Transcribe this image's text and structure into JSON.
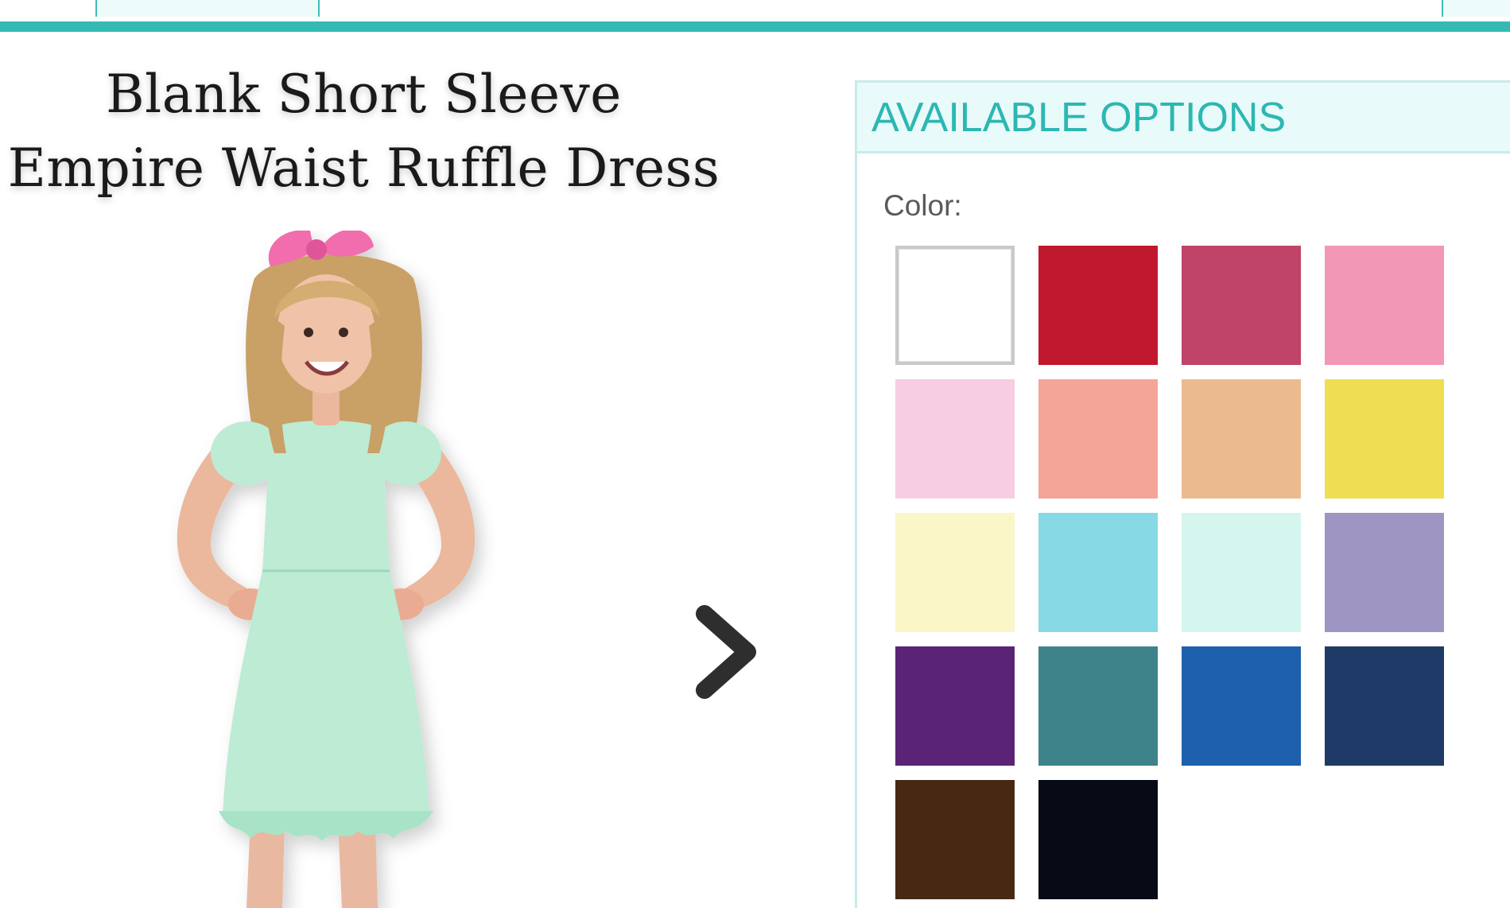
{
  "product": {
    "title": "Blank Short Sleeve Empire Waist Ruffle Dress"
  },
  "carousel": {
    "next_icon": "chevron-right-icon"
  },
  "options": {
    "header": "AVAILABLE OPTIONS",
    "color_label": "Color:",
    "selected_index": 0,
    "swatches": [
      {
        "color": "#FFFFFF"
      },
      {
        "color": "#C0192F"
      },
      {
        "color": "#C04468"
      },
      {
        "color": "#F297B6"
      },
      {
        "color": "#F6CDE3"
      },
      {
        "color": "#F4A597"
      },
      {
        "color": "#EBBB90"
      },
      {
        "color": "#F0DE52"
      },
      {
        "color": "#FBF6C7"
      },
      {
        "color": "#86D9E5"
      },
      {
        "color": "#D5F6EE"
      },
      {
        "color": "#9E95C3"
      },
      {
        "color": "#5B2376"
      },
      {
        "color": "#3E838A"
      },
      {
        "color": "#1E60AD"
      },
      {
        "color": "#1F3A66"
      },
      {
        "color": "#472913"
      },
      {
        "color": "#060B16"
      }
    ]
  },
  "colors": {
    "accent": "#34B9B4",
    "panel_bg": "#E8FAFA",
    "dress": "#BDEBD4",
    "bow": "#F26DAD"
  }
}
